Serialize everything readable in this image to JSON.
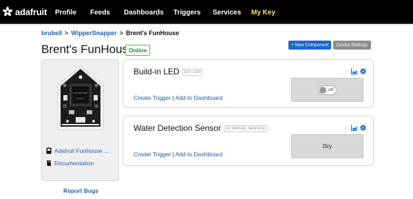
{
  "nav": {
    "brand": "adafruit",
    "items": [
      {
        "label": "Profile",
        "active": false
      },
      {
        "label": "Feeds",
        "active": false
      },
      {
        "label": "Dashboards",
        "active": false
      },
      {
        "label": "Triggers",
        "active": false
      },
      {
        "label": "Services",
        "active": false
      },
      {
        "label": "My Key",
        "active": true
      }
    ],
    "active_color": "#ffe14d"
  },
  "breadcrumb": {
    "user": "brubell",
    "section": "WipperSnapper",
    "current": "Brent's FunHouse",
    "separator": ">"
  },
  "device": {
    "title": "Brent's FunHouse",
    "status": "Online",
    "status_color": "#2e8b2e",
    "board_link": "Adafruit Funhouse ...",
    "docs_link": "Documentation",
    "report_bugs": "Report Bugs"
  },
  "actions": {
    "new_component": "+ New Component",
    "device_settings": "Device Settings"
  },
  "components": [
    {
      "name": "Build-in LED",
      "pin": "D37 LED",
      "create_trigger": "Create Trigger",
      "divider": "|",
      "add_dashboard": "Add to Dashboard",
      "toggle_state": "off"
    },
    {
      "name": "Water Detection Sensor",
      "pin": "D2 WATER_SENSOR",
      "create_trigger": "Create Trigger",
      "divider": "|",
      "add_dashboard": "Add to Dashboard",
      "value": "Dry"
    }
  ],
  "icons": {
    "brand": "adafruit-flower-icon",
    "chart": "chart-icon",
    "gear": "gear-icon",
    "board": "board-icon",
    "book": "book-icon"
  },
  "colors": {
    "link": "#2262b4",
    "primary_button": "#1a68c9",
    "secondary_button": "#8e8e8e"
  }
}
